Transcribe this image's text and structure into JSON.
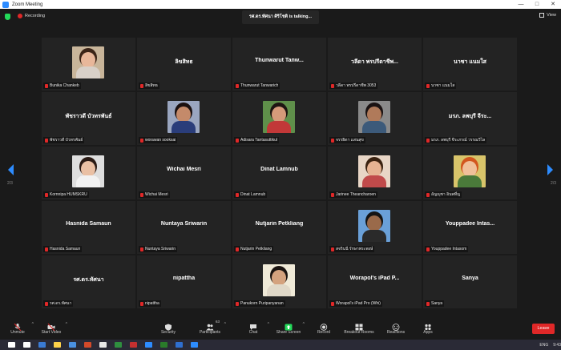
{
  "window": {
    "title": "Zoom Meeting",
    "controls": [
      "—",
      "□",
      "✕"
    ]
  },
  "topbar": {
    "recording": "Recording",
    "speaking": "รศ.ดร.ทัศนา ศิริโชติ is talking...",
    "view": "View"
  },
  "pagination": {
    "left": "2/3",
    "right": "2/3"
  },
  "tiles": [
    {
      "label": "Bunika Chankeb",
      "big": "",
      "video": true,
      "skin": "#e8b79a",
      "hair": "#3b2417",
      "shirt": "#d8d0c8",
      "bg": "#c8b59a"
    },
    {
      "label": "ลิขสิทธ",
      "big": "ลิขสิทธ",
      "video": false
    },
    {
      "label": "Thunwarut Tanwarich",
      "big": "Thunwarut Tanw...",
      "video": false
    },
    {
      "label": "วลีดา พรปรีดาชีพ 3053",
      "big": "วลีดา พรปรีดาชีพ...",
      "video": false
    },
    {
      "label": "นาซา แนมใส",
      "big": "นาซา แนมใส",
      "video": false
    },
    {
      "label": "พัชราวดี บัวทรพันธ์",
      "big": "พัชราวดี บัวทรพันธ์",
      "video": false
    },
    {
      "label": "worawan sooksai",
      "big": "",
      "video": true,
      "skin": "#c48a6a",
      "hair": "#1a1010",
      "shirt": "#2a3d7a",
      "bg": "#9aa6c0"
    },
    {
      "label": "Adisara Tantasuttikul",
      "big": "",
      "video": true,
      "skin": "#d59a7a",
      "hair": "#1e1512",
      "shirt": "#c23838",
      "bg": "#5f8f4a"
    },
    {
      "label": "จรรยิดา แสนสุข",
      "big": "",
      "video": true,
      "skin": "#b07a5a",
      "hair": "#1a1212",
      "shirt": "#3c5a7a",
      "bg": "#8a8a8a"
    },
    {
      "label": "มรภ. ลพบุรี จีระภรณ์ วรรณวิไล",
      "big": "มรภ. ลพบุรี จีระ...",
      "video": false
    },
    {
      "label": "Kornnipa HUMSKRU",
      "big": "",
      "video": true,
      "skin": "#eac0a4",
      "hair": "#2a1a14",
      "shirt": "#f2f2f2",
      "bg": "#dedede"
    },
    {
      "label": "Wichai Mesri",
      "big": "Wichai Mesri",
      "video": false
    },
    {
      "label": "Dinat Lamnub",
      "big": "Dinat Lamnub",
      "video": false
    },
    {
      "label": "Jarinee Theancharoen",
      "big": "",
      "video": true,
      "skin": "#e6b392",
      "hair": "#3a2210",
      "shirt": "#c04a4a",
      "bg": "#e8d6c6"
    },
    {
      "label": "อัญญุชา อินพที่ญ",
      "big": "",
      "video": true,
      "skin": "#f0c09a",
      "hair": "#d2561e",
      "shirt": "#4a7a3a",
      "bg": "#d8c46a"
    },
    {
      "label": "Hasnida Samaun",
      "big": "Hasnida Samaun",
      "video": false
    },
    {
      "label": "Nuntaya Sriwarin",
      "big": "Nuntaya Sriwarin",
      "video": false
    },
    {
      "label": "Nutjarin Petkliang",
      "big": "Nutjarin Petkliang",
      "video": false
    },
    {
      "label": "สจรินนี รักษาพระพงษ์",
      "big": "",
      "video": true,
      "skin": "#9a6a4a",
      "hair": "#141414",
      "shirt": "#2a2a2a",
      "bg": "#6aa0d8"
    },
    {
      "label": "Youppadee Intasom",
      "big": "Youppadee Intas...",
      "video": false
    },
    {
      "label": "รศ.ดร.ทัศนา",
      "big": "รศ.ดร.ทัศนา",
      "video": false
    },
    {
      "label": "nipattha",
      "big": "nipattha",
      "video": false
    },
    {
      "label": "Panukorn Puripanyanan",
      "big": "",
      "video": true,
      "skin": "#d4a27e",
      "hair": "#1a1310",
      "shirt": "#e0d8c8",
      "bg": "#f0ead8"
    },
    {
      "label": "Worapol's iPad Pro (Whi)",
      "big": "Worapol's iPad P...",
      "video": false
    },
    {
      "label": "Sanya",
      "big": "Sanya",
      "video": false
    }
  ],
  "toolbar": [
    {
      "label": "Unmute",
      "icon": "microphone-muted-icon",
      "caret": true
    },
    {
      "label": "Start Video",
      "icon": "video-off-icon",
      "caret": true
    },
    {
      "label": "Security",
      "icon": "shield-icon",
      "caret": false
    },
    {
      "label": "Participants",
      "icon": "participants-icon",
      "caret": true,
      "count": "63"
    },
    {
      "label": "Chat",
      "icon": "chat-icon",
      "caret": true
    },
    {
      "label": "Share Screen",
      "icon": "share-screen-icon",
      "caret": true
    },
    {
      "label": "Record",
      "icon": "record-icon",
      "caret": false
    },
    {
      "label": "Breakout Rooms",
      "icon": "breakout-rooms-icon",
      "caret": false
    },
    {
      "label": "Reactions",
      "icon": "reactions-icon",
      "caret": false
    },
    {
      "label": "Apps",
      "icon": "apps-icon",
      "caret": false
    }
  ],
  "leave": "Leave",
  "taskbar": {
    "apps": [
      "#ffffff",
      "#ffffff",
      "#3a7bd5",
      "#ffd24a",
      "#4a90e2",
      "#d44a2a",
      "#e8e8e8",
      "#2f8f3f",
      "#c43030",
      "#2d8cff",
      "#2a7a2a",
      "#2f6fd0",
      "#2d8cff"
    ],
    "lang": "ENG",
    "time": "9:43"
  },
  "colors": {
    "accent": "#2d8cff",
    "leave": "#e02828",
    "share": "#23d959"
  }
}
